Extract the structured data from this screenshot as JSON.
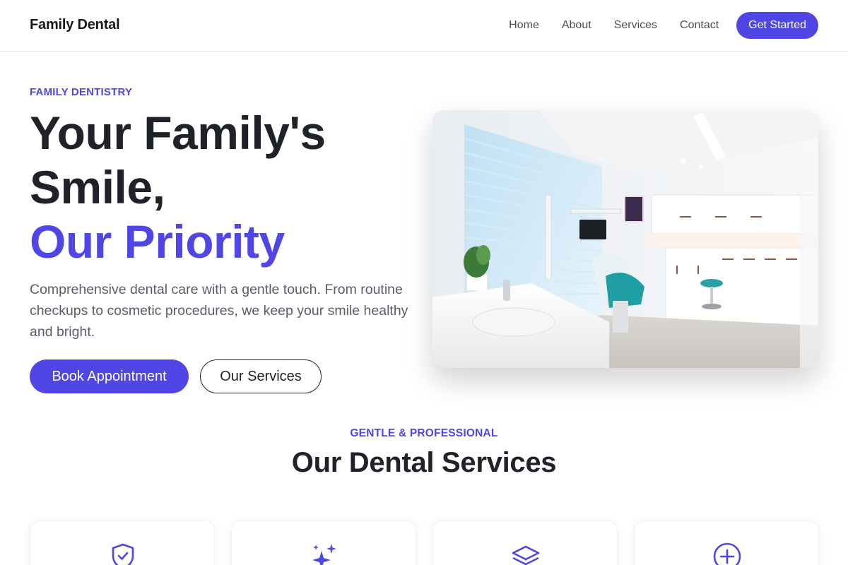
{
  "header": {
    "brand": "Family Dental",
    "nav": [
      "Home",
      "About",
      "Services",
      "Contact"
    ],
    "cta": "Get Started"
  },
  "hero": {
    "eyebrow": "FAMILY DENTISTRY",
    "title_line1": "Your Family's",
    "title_line2": "Smile,",
    "title_accent": "Our Priority",
    "description": "Comprehensive dental care with a gentle touch. From routine checkups to cosmetic procedures, we keep your smile healthy and bright.",
    "primary_button": "Book Appointment",
    "secondary_button": "Our Services"
  },
  "services": {
    "eyebrow": "GENTLE & PROFESSIONAL",
    "title": "Our Dental Services",
    "cards": [
      {
        "icon": "shield-check-icon"
      },
      {
        "icon": "sparkles-icon"
      },
      {
        "icon": "layers-icon"
      },
      {
        "icon": "plus-circle-icon"
      }
    ]
  },
  "colors": {
    "accent": "#4f46e5",
    "text": "#1f2229",
    "muted": "#5a5e67"
  }
}
